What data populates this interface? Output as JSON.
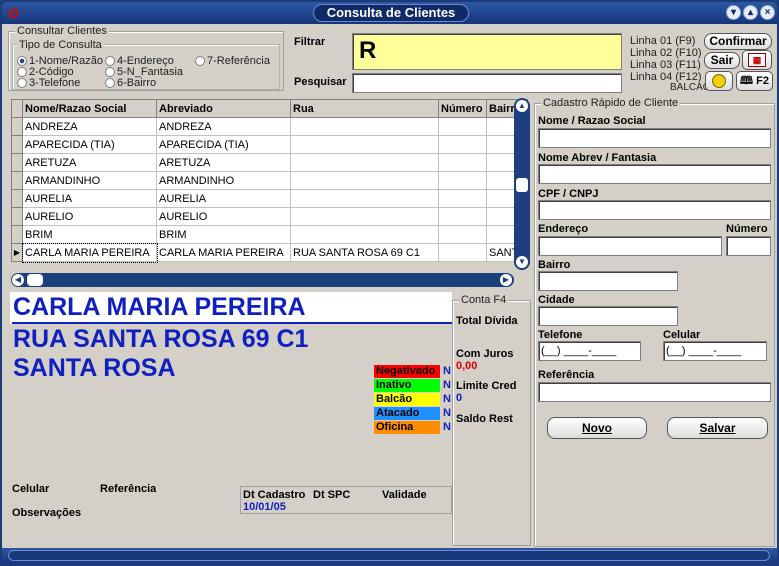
{
  "window": {
    "title": "Consulta de Clientes"
  },
  "consultar": {
    "group_title": "Consultar Clientes",
    "tipo_title": "Tipo de Consulta",
    "options": [
      "1-Nome/Razão",
      "2-Código",
      "3-Telefone",
      "4-Endereço",
      "5-N_Fantasia",
      "6-Bairro",
      "7-Referência"
    ],
    "selected": 0
  },
  "filtro": {
    "filtrar_label": "Filtrar",
    "filtrar_value": "R",
    "pesquisar_label": "Pesquisar",
    "pesquisar_value": ""
  },
  "linhas": [
    "Linha 01 (F9)",
    "Linha 02 (F10)",
    "Linha 03 (F11)",
    "Linha 04 (F12)"
  ],
  "balcao_label": "BALCAO",
  "buttons": {
    "confirmar": "Confirmar",
    "sair": "Sair",
    "f2": "F2",
    "novo": "Novo",
    "salvar": "Salvar"
  },
  "grid": {
    "columns": [
      "Nome/Razao Social",
      "Abreviado",
      "Rua",
      "Número",
      "Bairro"
    ],
    "rows": [
      [
        "ANDREZA",
        "ANDREZA",
        "",
        "",
        ""
      ],
      [
        "APARECIDA (TIA)",
        "APARECIDA (TIA)",
        "",
        "",
        ""
      ],
      [
        "ARETUZA",
        "ARETUZA",
        "",
        "",
        ""
      ],
      [
        "ARMANDINHO",
        "ARMANDINHO",
        "",
        "",
        ""
      ],
      [
        "AURELIA",
        "AURELIA",
        "",
        "",
        ""
      ],
      [
        "AURELIO",
        "AURELIO",
        "",
        "",
        ""
      ],
      [
        "BRIM",
        "BRIM",
        "",
        "",
        ""
      ],
      [
        "CARLA MARIA PEREIRA",
        "CARLA MARIA PEREIRA",
        "RUA SANTA ROSA 69 C1",
        "",
        "SANTA"
      ]
    ],
    "selected_row": 7
  },
  "detail": {
    "nome": "CARLA MARIA PEREIRA",
    "rua": "RUA SANTA ROSA 69 C1",
    "bairro": "SANTA ROSA",
    "flags": [
      {
        "label": "Negativado",
        "value": "N",
        "color": "#ff0000"
      },
      {
        "label": "Inativo",
        "value": "N",
        "color": "#00ff00"
      },
      {
        "label": "Balcão",
        "value": "N",
        "color": "#ffff00"
      },
      {
        "label": "Atacado",
        "value": "N",
        "color": "#1e90ff"
      },
      {
        "label": "Oficina",
        "value": "N",
        "color": "#ff8c00"
      }
    ],
    "celular_label": "Celular",
    "referencia_label": "Referência",
    "observacoes_label": "Observações",
    "dt_cadastro_label": "Dt Cadastro",
    "dt_spc_label": "Dt SPC",
    "validade_label": "Validade",
    "dt_cadastro_value": "10/01/05"
  },
  "conta": {
    "title": "Conta F4",
    "total_divida_label": "Total Dívida",
    "com_juros_label": "Com Juros",
    "com_juros_value": "0,00",
    "limite_label": "Limite Cred",
    "limite_value": "0",
    "saldo_label": "Saldo Rest"
  },
  "cadastro": {
    "title": "Cadastro Rápido de Cliente",
    "nome_label": "Nome / Razao Social",
    "fantasia_label": "Nome Abrev / Fantasia",
    "cpf_label": "CPF / CNPJ",
    "endereco_label": "Endereço",
    "numero_label": "Número",
    "bairro_label": "Bairro",
    "cidade_label": "Cidade",
    "telefone_label": "Telefone",
    "telefone_value": "(__) ____-____",
    "celular_label": "Celular",
    "celular_value": "(__) ____-____",
    "referencia_label": "Referência"
  }
}
